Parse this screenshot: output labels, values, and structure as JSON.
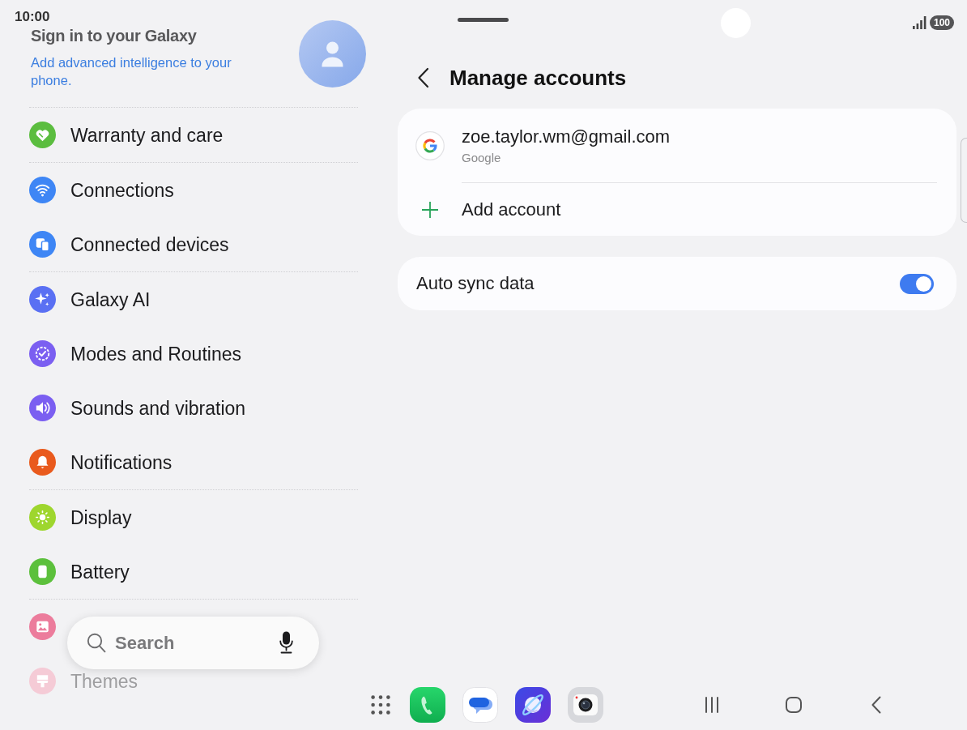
{
  "status_bar": {
    "time": "10:00",
    "battery": "100"
  },
  "sidebar": {
    "profile": {
      "title": "Sign in to your Galaxy",
      "subtitle": "Add advanced intelligence to your phone."
    },
    "groups": [
      [
        {
          "label": "Warranty and care",
          "color": "#5bbd3f"
        }
      ],
      [
        {
          "label": "Connections",
          "color": "#3e86f5"
        },
        {
          "label": "Connected devices",
          "color": "#3e86f5"
        }
      ],
      [
        {
          "label": "Galaxy AI",
          "color": "#5a70f3"
        },
        {
          "label": "Modes and Routines",
          "color": "#7b5ff1"
        },
        {
          "label": "Sounds and vibration",
          "color": "#7b5ff1"
        },
        {
          "label": "Notifications",
          "color": "#e95a1d"
        }
      ],
      [
        {
          "label": "Display",
          "color": "#9ed62e"
        },
        {
          "label": "Battery",
          "color": "#5cc03c"
        }
      ],
      [
        {
          "color": "#ec7c9c"
        },
        {
          "label": "Themes",
          "color": "#f5cbd6"
        }
      ]
    ],
    "search": {
      "placeholder": "Search"
    }
  },
  "page": {
    "title": "Manage accounts",
    "accounts": [
      {
        "email": "zoe.taylor.wm@gmail.com",
        "type": "Google"
      }
    ],
    "add_account": "Add account",
    "auto_sync": {
      "label": "Auto sync data",
      "on": true
    }
  }
}
